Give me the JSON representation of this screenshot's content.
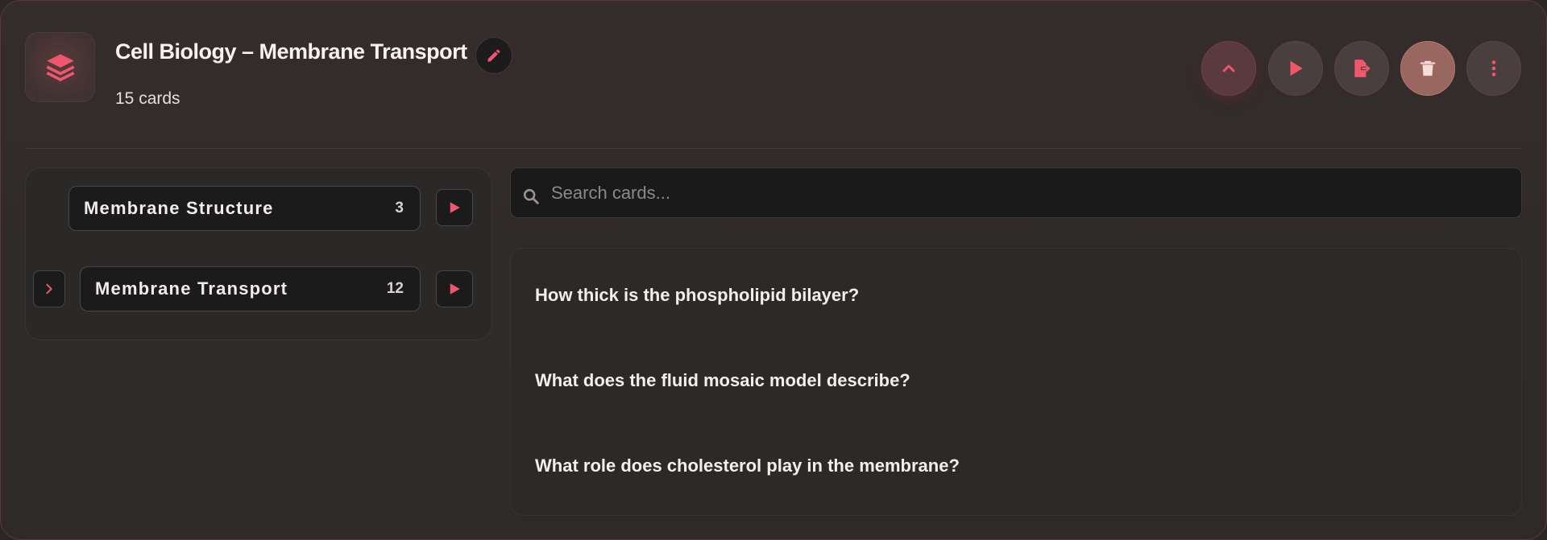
{
  "deck": {
    "title": "Cell Biology – Membrane Transport",
    "card_count": "15 cards"
  },
  "toolbar": {
    "collapse_icon": "chevron-up-icon",
    "study_icon": "play-icon",
    "export_icon": "file-export-icon",
    "delete_icon": "trash-icon",
    "more_icon": "more-vertical-icon"
  },
  "topics": [
    {
      "name": "Membrane Structure",
      "count": "3"
    },
    {
      "name": "Membrane Transport",
      "count": "12"
    }
  ],
  "search": {
    "placeholder": "Search cards...",
    "value": ""
  },
  "cards": [
    {
      "question": "How thick is the phospholipid bilayer?"
    },
    {
      "question": "What does the fluid mosaic model describe?"
    },
    {
      "question": "What role does cholesterol play in the membrane?"
    }
  ],
  "colors": {
    "accent": "#f0566e",
    "background": "#2f2b29",
    "surface": "#1c1b1b"
  }
}
